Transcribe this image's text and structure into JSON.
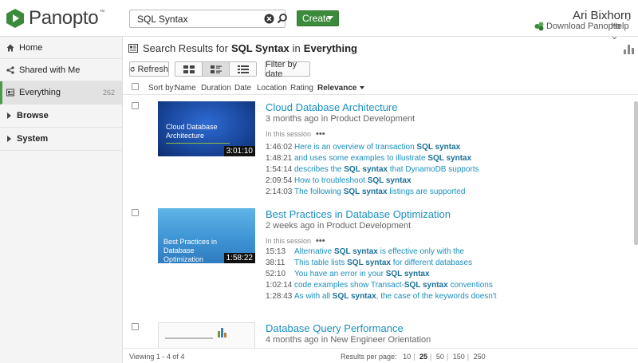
{
  "header": {
    "logo_text": "Panopto",
    "logo_tm": "™",
    "search_value": "SQL Syntax",
    "create_label": "Create",
    "user_name": "Ari Bixhorn",
    "download_label": "Download Panopto",
    "help_label": "Help"
  },
  "sidebar": {
    "items": [
      {
        "label": "Home",
        "icon": "home-icon"
      },
      {
        "label": "Shared with Me",
        "icon": "share-icon"
      },
      {
        "label": "Everything",
        "icon": "everything-icon",
        "count": "262"
      },
      {
        "label": "Browse",
        "icon": "triangle-right-icon"
      },
      {
        "label": "System",
        "icon": "triangle-right-icon"
      }
    ]
  },
  "results_header": {
    "prefix": "Search Results for",
    "query": "SQL Syntax",
    "in_word": "in",
    "scope": "Everything"
  },
  "toolbar": {
    "refresh_label": "Refresh",
    "filter_label": "Filter by date"
  },
  "sort": {
    "label": "Sort by:",
    "options": [
      "Name",
      "Duration",
      "Date",
      "Location",
      "Rating",
      "Relevance"
    ]
  },
  "results": [
    {
      "title": "Cloud Database Architecture",
      "meta": "3 months ago in Product Development",
      "thumb_title": "Cloud Database Architecture",
      "duration": "3:01:10",
      "in_session": "In this session",
      "hits": [
        {
          "time": "1:46:02",
          "pre": "Here is an overview of transaction ",
          "term": "SQL syntax",
          "post": ""
        },
        {
          "time": "1:48:21",
          "pre": "and uses some examples to illustrate ",
          "term": "SQL syntax",
          "post": ""
        },
        {
          "time": "1:54:14",
          "pre": "describes the ",
          "term": "SQL syntax",
          "post": " that DynamoDB supports"
        },
        {
          "time": "2:09:54",
          "pre": "How to troubleshoot ",
          "term": "SQL syntax",
          "post": ""
        },
        {
          "time": "2:14:03",
          "pre": "The following ",
          "term": "SQL syntax",
          "post": " listings are supported"
        }
      ]
    },
    {
      "title": "Best Practices in Database Optimization",
      "meta": "2 weeks ago in Product Development",
      "thumb_title": "Best Practices in Database Optimization",
      "duration": "1:58:22",
      "in_session": "In this session",
      "hits": [
        {
          "time": "15:13",
          "pre": "Alternative ",
          "term": "SQL syntax",
          "post": " is effective only with the"
        },
        {
          "time": "38:11",
          "pre": "This table lists ",
          "term": "SQL syntax",
          "post": " for different databases"
        },
        {
          "time": "52:10",
          "pre": "You have an error in your ",
          "term": "SQL syntax",
          "post": ""
        },
        {
          "time": "1:02:14",
          "pre": "code examples show Transact-",
          "term": "SQL syntax",
          "post": " conventions"
        },
        {
          "time": "1:28:43",
          "pre": "As with all ",
          "term": "SQL syntax",
          "post": ", the case of the keywords doesn't"
        }
      ]
    },
    {
      "title": "Database Query Performance",
      "meta": "4 months ago in New Engineer Orientation"
    }
  ],
  "footer": {
    "viewing": "Viewing 1 - 4 of 4",
    "rpp_label": "Results per page:",
    "rpp_options": [
      "10",
      "25",
      "50",
      "150",
      "250"
    ],
    "rpp_selected": "25"
  },
  "colors": {
    "brand_green": "#3c8b3c",
    "link_blue": "#1a8fbf"
  }
}
